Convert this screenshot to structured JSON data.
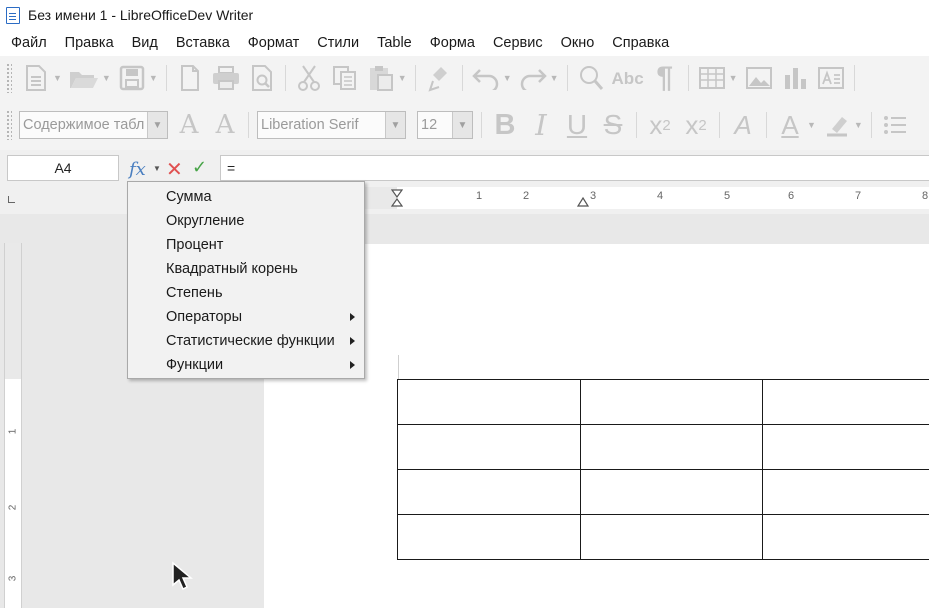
{
  "window": {
    "title": "Без имени 1 - LibreOfficeDev Writer"
  },
  "menubar": {
    "items": [
      "Файл",
      "Правка",
      "Вид",
      "Вставка",
      "Формат",
      "Стили",
      "Table",
      "Форма",
      "Сервис",
      "Окно",
      "Справка"
    ]
  },
  "toolbar_standard": {
    "icons": [
      "new-document-icon",
      "open-folder-icon",
      "save-icon",
      "export-pdf-icon",
      "print-icon",
      "print-preview-icon",
      "cut-icon",
      "copy-icon",
      "paste-icon",
      "clone-formatting-icon",
      "undo-icon",
      "redo-icon",
      "find-replace-icon",
      "spelling-icon",
      "formatting-marks-icon",
      "insert-table-icon",
      "insert-image-icon",
      "insert-chart-icon",
      "insert-textbox-icon"
    ]
  },
  "toolbar_formatting": {
    "paragraph_style": "Содержимое табл",
    "font_name": "Liberation Serif",
    "font_size": "12"
  },
  "formula_bar": {
    "cell_reference": "A4",
    "formula": "="
  },
  "ruler": {
    "numbers": [
      "1",
      "2",
      "3",
      "4",
      "5",
      "6",
      "7",
      "8"
    ]
  },
  "formula_menu": {
    "items": [
      {
        "label": "Сумма",
        "submenu": false
      },
      {
        "label": "Округление",
        "submenu": false
      },
      {
        "label": "Процент",
        "submenu": false
      },
      {
        "label": "Квадратный корень",
        "submenu": false
      },
      {
        "label": "Степень",
        "submenu": false
      },
      {
        "label": "Операторы",
        "submenu": true
      },
      {
        "label": "Статистические функции",
        "submenu": true
      },
      {
        "label": "Функции",
        "submenu": true
      }
    ]
  },
  "vruler": {
    "numbers": [
      "1",
      "2",
      "3"
    ]
  },
  "colors": {
    "cancel": "#e05050",
    "accept": "#47a447",
    "fx": "#4a7fc0"
  }
}
